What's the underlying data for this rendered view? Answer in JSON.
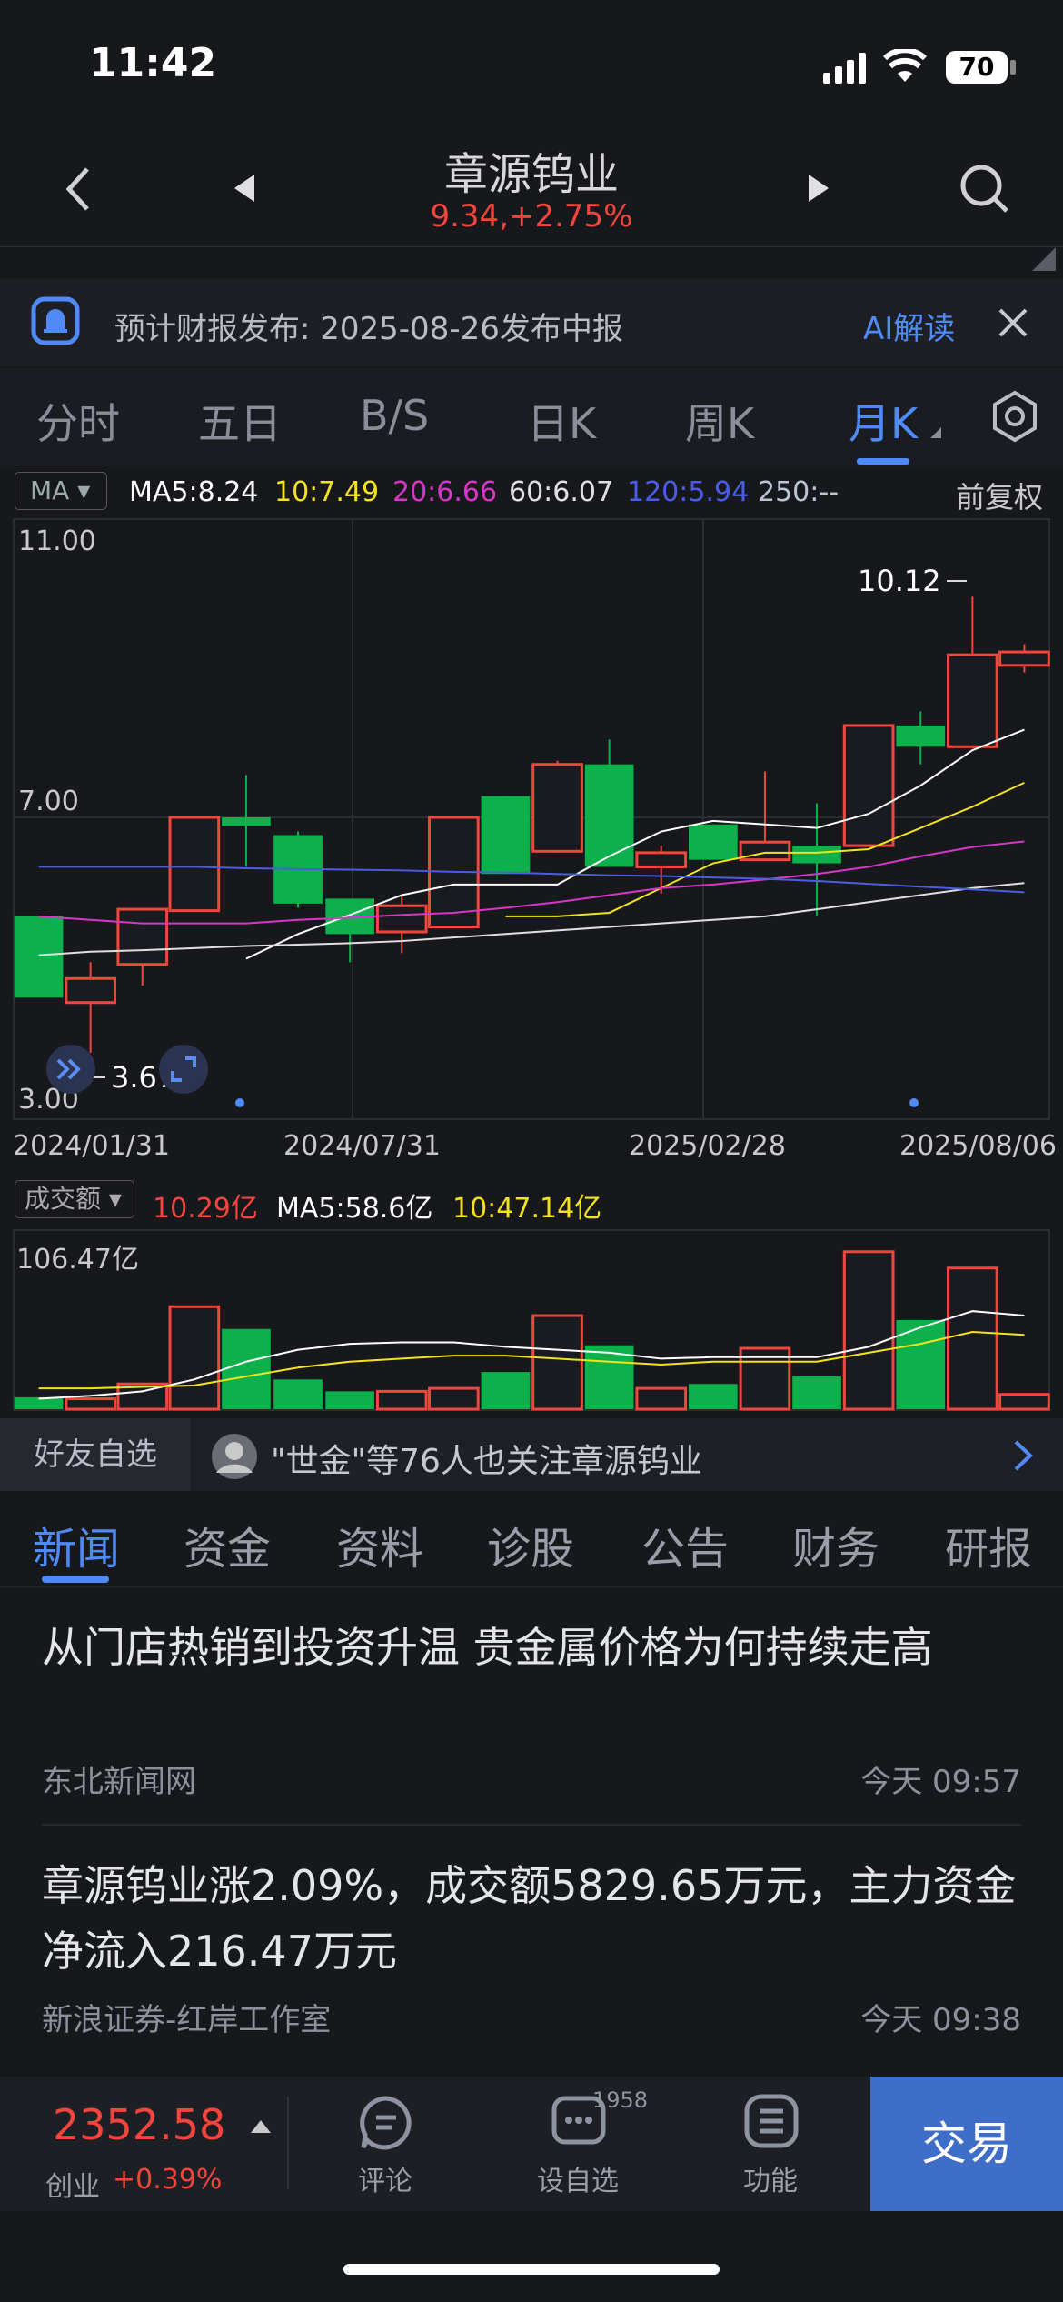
{
  "status": {
    "time": "11:42",
    "battery": "70"
  },
  "header": {
    "stock_name": "章源钨业",
    "price_change": "9.34,+2.75%"
  },
  "banner": {
    "text": "预计财报发布: 2025-08-26发布中报",
    "ai_label": "AI解读"
  },
  "tabs": [
    "分时",
    "五日",
    "B/S",
    "日K",
    "周K",
    "月K"
  ],
  "ma": {
    "select": "MA",
    "items": [
      {
        "label": "MA5:8.24",
        "color": "#ffffff"
      },
      {
        "label": "10:7.49",
        "color": "#f4e21c"
      },
      {
        "label": "20:6.66",
        "color": "#d836c9"
      },
      {
        "label": "60:6.07",
        "color": "#e0e0e0"
      },
      {
        "label": "120:5.94",
        "color": "#4b5ce6"
      },
      {
        "label": "250:--",
        "color": "#b9c4d6"
      }
    ],
    "adjust": "前复权"
  },
  "chart_data": {
    "type": "candlestick",
    "ylim": [
      3.0,
      11.0
    ],
    "y_ticks": [
      "11.00",
      "7.00",
      "3.00"
    ],
    "x_labels": [
      "2024/01/31",
      "2024/07/31",
      "2025/02/28",
      "2025/08/06"
    ],
    "max_label": "10.12",
    "min_label": "3.67",
    "candles": [
      {
        "o": 5.6,
        "h": 5.6,
        "c": 4.45,
        "l": 4.45
      },
      {
        "o": 4.38,
        "h": 4.95,
        "c": 4.72,
        "l": 3.67
      },
      {
        "o": 4.92,
        "h": 5.7,
        "c": 5.7,
        "l": 4.62
      },
      {
        "o": 5.68,
        "h": 7.0,
        "c": 7.0,
        "l": 5.68
      },
      {
        "o": 7.0,
        "h": 7.6,
        "c": 6.88,
        "l": 6.3
      },
      {
        "o": 6.75,
        "h": 6.8,
        "c": 5.78,
        "l": 5.72
      },
      {
        "o": 5.85,
        "h": 5.85,
        "c": 5.35,
        "l": 4.95
      },
      {
        "o": 5.38,
        "h": 5.9,
        "c": 5.75,
        "l": 5.08
      },
      {
        "o": 5.45,
        "h": 7.0,
        "c": 7.0,
        "l": 5.45
      },
      {
        "o": 7.3,
        "h": 7.3,
        "c": 6.2,
        "l": 6.2
      },
      {
        "o": 6.52,
        "h": 7.8,
        "c": 7.75,
        "l": 6.5
      },
      {
        "o": 7.75,
        "h": 8.1,
        "c": 6.3,
        "l": 6.3
      },
      {
        "o": 6.3,
        "h": 6.6,
        "c": 6.5,
        "l": 5.92
      },
      {
        "o": 6.9,
        "h": 6.9,
        "c": 6.4,
        "l": 6.4
      },
      {
        "o": 6.4,
        "h": 7.65,
        "c": 6.65,
        "l": 6.4
      },
      {
        "o": 6.6,
        "h": 7.2,
        "c": 6.35,
        "l": 5.6
      },
      {
        "o": 6.6,
        "h": 8.05,
        "c": 8.3,
        "l": 6.6
      },
      {
        "o": 8.3,
        "h": 8.5,
        "c": 8.0,
        "l": 7.75
      },
      {
        "o": 8.0,
        "h": 10.12,
        "c": 9.3,
        "l": 8.0
      },
      {
        "o": 9.15,
        "h": 9.45,
        "c": 9.34,
        "l": 9.05
      }
    ],
    "ma_lines": [
      {
        "name": "MA5",
        "color": "#ffffff",
        "values": [
          null,
          null,
          null,
          null,
          5.0,
          5.35,
          5.62,
          5.9,
          6.05,
          6.05,
          6.05,
          6.45,
          6.8,
          6.95,
          6.9,
          6.85,
          7.05,
          7.45,
          7.95,
          8.24
        ]
      },
      {
        "name": "MA10",
        "color": "#f4e21c",
        "values": [
          null,
          null,
          null,
          null,
          null,
          null,
          null,
          null,
          null,
          5.6,
          5.6,
          5.65,
          6.0,
          6.35,
          6.5,
          6.5,
          6.55,
          6.85,
          7.15,
          7.49
        ]
      },
      {
        "name": "MA20",
        "color": "#d836c9",
        "values": [
          5.6,
          5.55,
          5.5,
          5.5,
          5.5,
          5.55,
          5.58,
          5.62,
          5.65,
          5.72,
          5.8,
          5.9,
          6.0,
          6.05,
          6.12,
          6.2,
          6.3,
          6.45,
          6.58,
          6.66
        ]
      },
      {
        "name": "MA60",
        "color": "#e0e0e0",
        "values": [
          5.05,
          5.1,
          5.12,
          5.15,
          5.18,
          5.2,
          5.22,
          5.25,
          5.3,
          5.35,
          5.4,
          5.45,
          5.5,
          5.55,
          5.6,
          5.7,
          5.8,
          5.9,
          6.0,
          6.07
        ]
      },
      {
        "name": "MA120",
        "color": "#4b5ce6",
        "values": [
          6.3,
          6.3,
          6.3,
          6.3,
          6.28,
          6.27,
          6.26,
          6.25,
          6.23,
          6.22,
          6.2,
          6.18,
          6.17,
          6.15,
          6.13,
          6.1,
          6.06,
          6.02,
          5.98,
          5.94
        ]
      }
    ]
  },
  "volume": {
    "select": "成交额",
    "current": "10.29亿",
    "ma5": "MA5:58.6亿",
    "ma10": "10:47.14亿",
    "max_label": "106.47亿",
    "bars": [
      {
        "v": 8,
        "up": false
      },
      {
        "v": 7,
        "up": true
      },
      {
        "v": 17,
        "up": true
      },
      {
        "v": 69,
        "up": true
      },
      {
        "v": 54,
        "up": false
      },
      {
        "v": 20,
        "up": false
      },
      {
        "v": 12,
        "up": false
      },
      {
        "v": 12,
        "up": true
      },
      {
        "v": 14,
        "up": true
      },
      {
        "v": 25,
        "up": false
      },
      {
        "v": 63,
        "up": true
      },
      {
        "v": 43,
        "up": false
      },
      {
        "v": 14,
        "up": true
      },
      {
        "v": 17,
        "up": false
      },
      {
        "v": 41,
        "up": true
      },
      {
        "v": 22,
        "up": false
      },
      {
        "v": 106,
        "up": true
      },
      {
        "v": 60,
        "up": false
      },
      {
        "v": 95,
        "up": true
      },
      {
        "v": 10,
        "up": true
      }
    ],
    "ma5_line": [
      7,
      9,
      12,
      20,
      32,
      40,
      44,
      45,
      45,
      42,
      40,
      38,
      34,
      35,
      35,
      35,
      42,
      55,
      66,
      63
    ],
    "ma10_line": [
      14,
      14,
      15,
      16,
      22,
      28,
      32,
      34,
      36,
      36,
      34,
      32,
      30,
      32,
      32,
      32,
      38,
      44,
      52,
      50
    ]
  },
  "friends": {
    "tag": "好友自选",
    "text": "\"世金\"等76人也关注章源钨业"
  },
  "news_tabs": [
    "新闻",
    "资金",
    "资料",
    "诊股",
    "公告",
    "财务",
    "研报"
  ],
  "news": [
    {
      "title": "从门店热销到投资升温 贵金属价格为何持续走高",
      "source": "东北新闻网",
      "time": "今天 09:57"
    },
    {
      "title": "章源钨业涨2.09%，成交额5829.65万元，主力资金净流入216.47万元",
      "source": "新浪证券-红岸工作室",
      "time": "今天 09:38"
    }
  ],
  "bottom": {
    "index_value": "2352.58",
    "index_name": "创业",
    "index_change": "+0.39%",
    "comment": "评论",
    "watchlist": "设自选",
    "watch_count": "1958",
    "function": "功能",
    "trade": "交易"
  }
}
